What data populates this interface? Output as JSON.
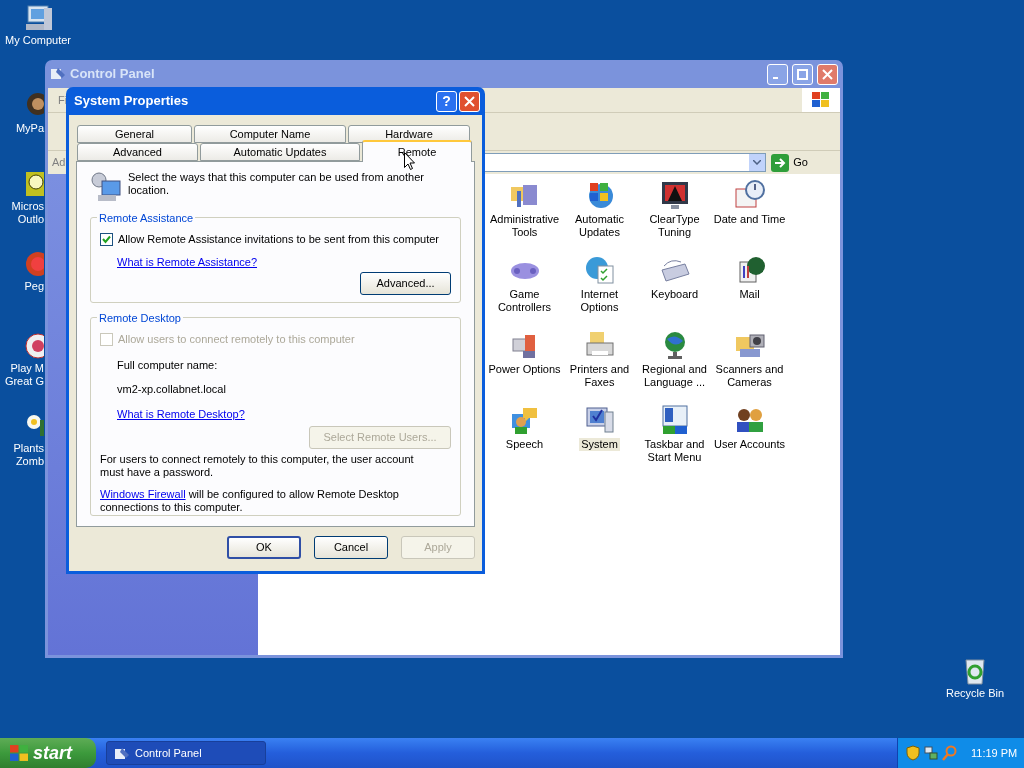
{
  "desktop_icons": [
    {
      "lines": [
        "My Computer"
      ]
    },
    {
      "lines": [
        "MyPa"
      ]
    },
    {
      "lines": [
        "Micros",
        "Outlo"
      ]
    },
    {
      "lines": [
        "Peg"
      ]
    },
    {
      "lines": [
        "Play M",
        "Great G"
      ]
    },
    {
      "lines": [
        "Plants",
        "Zomb"
      ]
    }
  ],
  "recycle_bin": {
    "label": "Recycle Bin"
  },
  "control_panel": {
    "title": "Control Panel",
    "menu_partial": "Fi",
    "address_partial": "Ad",
    "go": "Go",
    "items": [
      {
        "lines": [
          "Administrative",
          "Tools"
        ],
        "selected": false
      },
      {
        "lines": [
          "Automatic",
          "Updates"
        ],
        "selected": false
      },
      {
        "lines": [
          "ClearType",
          "Tuning"
        ],
        "selected": false
      },
      {
        "lines": [
          "Date and Time"
        ],
        "selected": false
      },
      {
        "lines": [
          "Game",
          "Controllers"
        ],
        "selected": false
      },
      {
        "lines": [
          "Internet",
          "Options"
        ],
        "selected": false
      },
      {
        "lines": [
          "Keyboard"
        ],
        "selected": false
      },
      {
        "lines": [
          "Mail"
        ],
        "selected": false
      },
      {
        "lines": [
          "Power Options"
        ],
        "selected": false
      },
      {
        "lines": [
          "Printers and",
          "Faxes"
        ],
        "selected": false
      },
      {
        "lines": [
          "Regional and",
          "Language ..."
        ],
        "selected": false
      },
      {
        "lines": [
          "Scanners and",
          "Cameras"
        ],
        "selected": false
      },
      {
        "lines": [
          "Speech"
        ],
        "selected": false
      },
      {
        "lines": [
          "System"
        ],
        "selected": true
      },
      {
        "lines": [
          "Taskbar and",
          "Start Menu"
        ],
        "selected": false
      },
      {
        "lines": [
          "User Accounts"
        ],
        "selected": false
      }
    ]
  },
  "dialog": {
    "title": "System Properties",
    "help": "?",
    "tab_rows": [
      [
        {
          "label": "General",
          "selected": false
        },
        {
          "label": "Computer Name",
          "selected": false
        },
        {
          "label": "Hardware",
          "selected": false
        }
      ],
      [
        {
          "label": "Advanced",
          "selected": false
        },
        {
          "label": "Automatic Updates",
          "selected": false
        },
        {
          "label": "Remote",
          "selected": true
        }
      ]
    ],
    "intro": "Select the ways that this computer can be used from another location.",
    "remote_assistance": {
      "legend": "Remote Assistance",
      "checkbox": {
        "label": "Allow Remote Assistance invitations to be sent from this computer",
        "checked": true,
        "disabled": false
      },
      "link": "What is Remote Assistance?",
      "button": {
        "label": "Advanced...",
        "disabled": false
      }
    },
    "remote_desktop": {
      "legend": "Remote Desktop",
      "checkbox": {
        "label": "Allow users to connect remotely to this computer",
        "checked": false,
        "disabled": true
      },
      "name_label": "Full computer name:",
      "name_value": "vm2-xp.collabnet.local",
      "link": "What is Remote Desktop?",
      "button": {
        "label": "Select Remote Users...",
        "disabled": true
      },
      "note": "For users to connect remotely to this computer, the user account must have a password.",
      "firewall_link": "Windows Firewall",
      "firewall_text": "will be configured to allow Remote Desktop connections to this computer."
    },
    "buttons": [
      {
        "label": "OK",
        "disabled": false,
        "default": true
      },
      {
        "label": "Cancel",
        "disabled": false,
        "default": false
      },
      {
        "label": "Apply",
        "disabled": true,
        "default": false
      }
    ]
  },
  "taskbar": {
    "start": "start",
    "tasks": [
      {
        "label": "Control Panel",
        "selected": true
      }
    ],
    "clock": "11:19 PM"
  }
}
